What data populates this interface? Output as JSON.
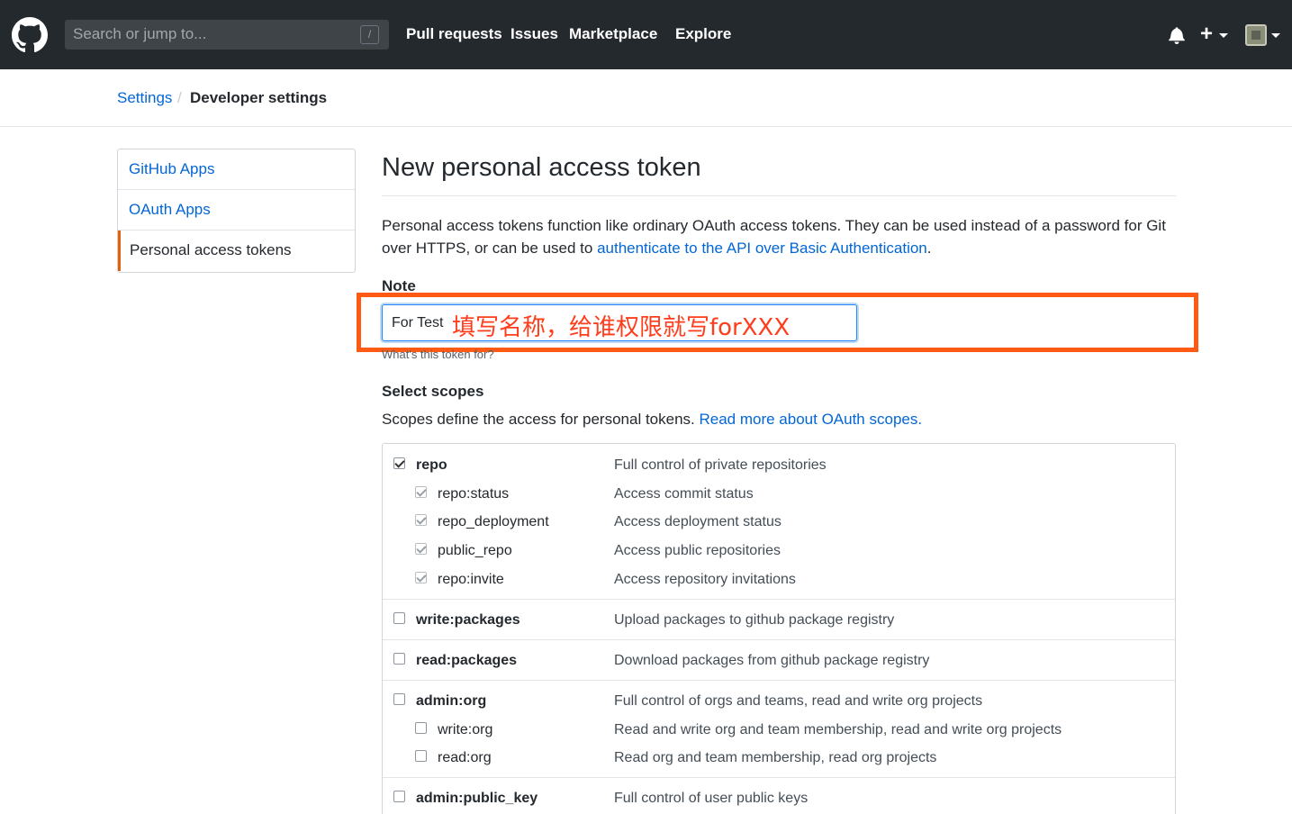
{
  "header": {
    "search_placeholder": "Search or jump to...",
    "search_shortcut": "/",
    "nav": [
      "Pull requests",
      "Issues",
      "Marketplace",
      "Explore"
    ],
    "plus_label": "+"
  },
  "breadcrumb": {
    "parent": "Settings",
    "separator": "/",
    "current": "Developer settings"
  },
  "sidebar": {
    "items": [
      {
        "label": "GitHub Apps"
      },
      {
        "label": "OAuth Apps"
      },
      {
        "label": "Personal access tokens"
      }
    ]
  },
  "main": {
    "title": "New personal access token",
    "desc_prefix": "Personal access tokens function like ordinary OAuth access tokens. They can be used instead of a password for Git over HTTPS, or can be used to ",
    "desc_link": "authenticate to the API over Basic Authentication",
    "desc_suffix": ".",
    "note_label": "Note",
    "note_value": "For Test",
    "note_hint": "What's this token for?",
    "annotation": "填写名称，给谁权限就写forXXX",
    "scopes_title": "Select scopes",
    "scopes_desc_prefix": "Scopes define the access for personal tokens. ",
    "scopes_desc_link": "Read more about OAuth scopes."
  },
  "scopes": [
    {
      "name": "repo",
      "desc": "Full control of private repositories",
      "checked": true,
      "children": [
        {
          "name": "repo:status",
          "desc": "Access commit status",
          "checked": true
        },
        {
          "name": "repo_deployment",
          "desc": "Access deployment status",
          "checked": true
        },
        {
          "name": "public_repo",
          "desc": "Access public repositories",
          "checked": true
        },
        {
          "name": "repo:invite",
          "desc": "Access repository invitations",
          "checked": true
        }
      ]
    },
    {
      "name": "write:packages",
      "desc": "Upload packages to github package registry",
      "checked": false,
      "children": []
    },
    {
      "name": "read:packages",
      "desc": "Download packages from github package registry",
      "checked": false,
      "children": []
    },
    {
      "name": "admin:org",
      "desc": "Full control of orgs and teams, read and write org projects",
      "checked": false,
      "children": [
        {
          "name": "write:org",
          "desc": "Read and write org and team membership, read and write org projects",
          "checked": false
        },
        {
          "name": "read:org",
          "desc": "Read org and team membership, read org projects",
          "checked": false
        }
      ]
    },
    {
      "name": "admin:public_key",
      "desc": "Full control of user public keys",
      "checked": false,
      "children": []
    }
  ],
  "colors": {
    "header_bg": "#24292e",
    "link": "#0366d6",
    "annotation": "#ff5a14",
    "active_tab": "#e36209"
  }
}
